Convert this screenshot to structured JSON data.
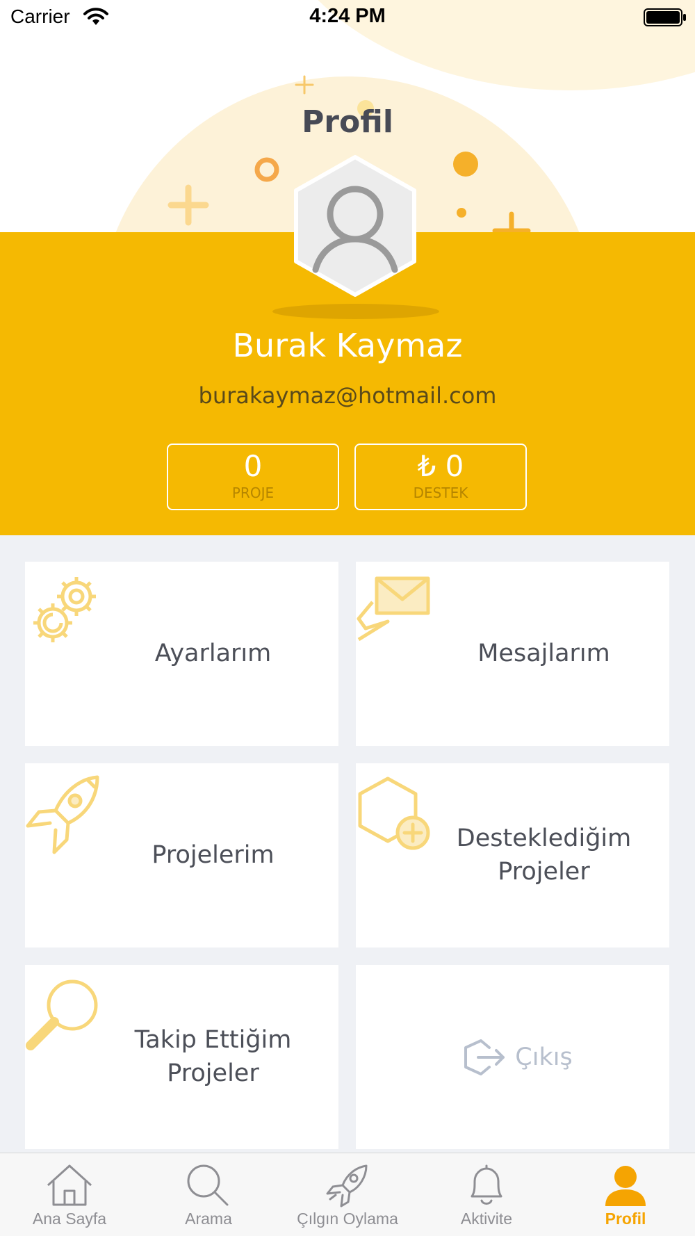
{
  "status_bar": {
    "carrier": "Carrier",
    "time": "4:24 PM"
  },
  "header": {
    "title": "Profil"
  },
  "profile": {
    "name": "Burak Kaymaz",
    "email": "burakaymaz@hotmail.com"
  },
  "stats": {
    "projects": {
      "value": "0",
      "label": "PROJE"
    },
    "support": {
      "value": "₺ 0",
      "label": "DESTEK"
    }
  },
  "menu": {
    "settings": "Ayarlarım",
    "messages": "Mesajlarım",
    "my_projects": "Projelerim",
    "supported_projects": "Desteklediğim Projeler",
    "followed_projects": "Takip Ettiğim Projeler",
    "logout": "Çıkış"
  },
  "tabs": [
    {
      "label": "Ana Sayfa",
      "icon": "home-icon"
    },
    {
      "label": "Arama",
      "icon": "search-icon"
    },
    {
      "label": "Çılgın Oylama",
      "icon": "rocket-icon"
    },
    {
      "label": "Aktivite",
      "icon": "bell-icon"
    },
    {
      "label": "Profil",
      "icon": "user-icon"
    }
  ],
  "colors": {
    "brand_yellow": "#f5b902",
    "active_tab": "#f5a402",
    "icon_yellow": "#f8d77a"
  }
}
